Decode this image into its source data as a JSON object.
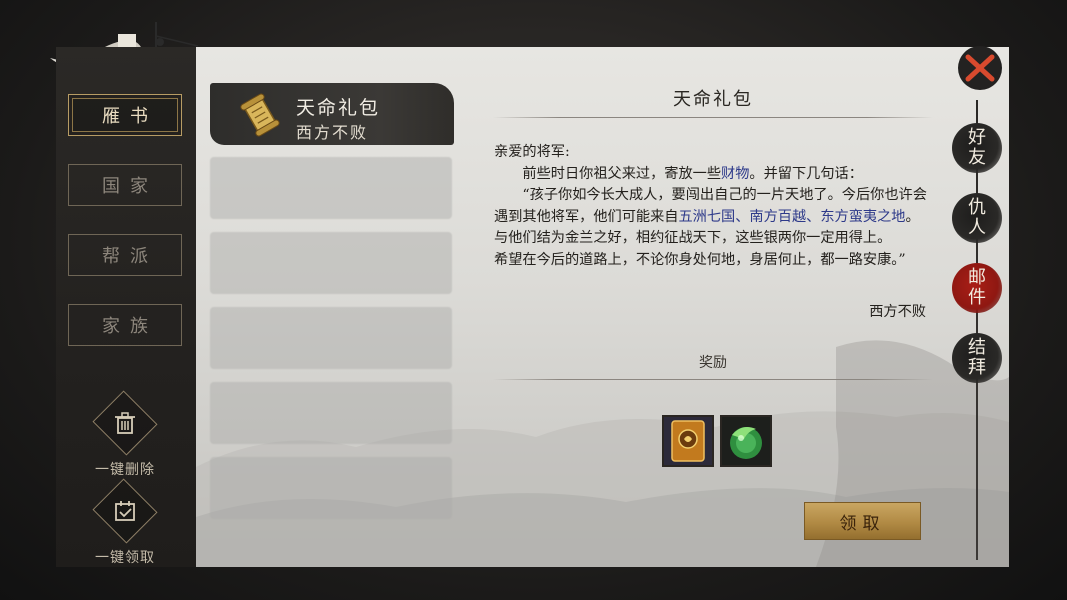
{
  "sidebar": {
    "tabs": [
      {
        "label": "雁书",
        "active": true
      },
      {
        "label": "国家",
        "active": false
      },
      {
        "label": "帮派",
        "active": false
      },
      {
        "label": "家族",
        "active": false
      }
    ],
    "actions": [
      {
        "label": "一键删除",
        "icon": "trash-icon"
      },
      {
        "label": "一键领取",
        "icon": "calendar-check-icon"
      }
    ]
  },
  "mail_list": {
    "selected": {
      "title": "天命礼包",
      "sender": "西方不败",
      "icon": "scroll-icon"
    },
    "placeholder_count": 5
  },
  "mail": {
    "title": "天命礼包",
    "greeting": "亲爱的将军:",
    "line1_a": "前些时日你祖父来过，寄放一些",
    "line1_hl": "财物",
    "line1_b": "。并留下几句话：",
    "para2_a": "“孩子你如今长大成人，要闯出自己的一片天地了。今后你也许会遇到其他将军，他们可能来自",
    "para2_hl": "五洲七国、南方百越、东方蛮夷之地",
    "para2_b": "。与他们结为金兰之好，相约征战天下，这些银两你一定用得上。",
    "para3": "希望在今后的道路上，不论你身处何地，身居何止，都一路安康。”",
    "signature": "西方不败",
    "reward_label": "奖励",
    "rewards": [
      {
        "icon": "gold-token-card-icon"
      },
      {
        "icon": "green-jade-orb-icon"
      }
    ],
    "claim_label": "领取",
    "highlight_color": "#2e3a8a"
  },
  "right_tabs": [
    {
      "label": "好友",
      "active": false
    },
    {
      "label": "仇人",
      "active": false
    },
    {
      "label": "邮件",
      "active": true
    },
    {
      "label": "结拜",
      "active": false
    }
  ],
  "colors": {
    "accent_red": "#a91e16",
    "gold": "#c9a662"
  }
}
